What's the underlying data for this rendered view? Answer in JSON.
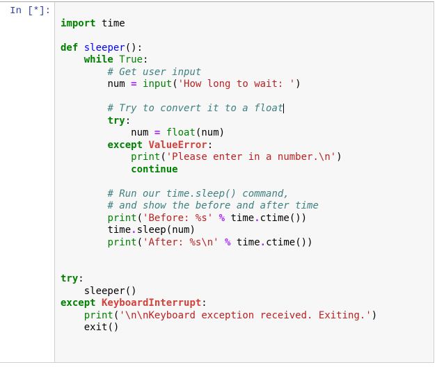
{
  "prompt": {
    "prefix": "In [",
    "indicator": "*",
    "suffix": "]:"
  },
  "code": {
    "l01_kw": "import",
    "l01_nm": " time",
    "l03_kw": "def",
    "l03_fn": " sleeper",
    "l03_pn": "():",
    "l04_sp": "    ",
    "l04_kw": "while",
    "l04_bi": " True",
    "l04_pn": ":",
    "l05_sp": "        ",
    "l05_cm": "# Get user input",
    "l06_sp": "        ",
    "l06_nm1": "num ",
    "l06_op": "=",
    "l06_nm2": " ",
    "l06_bi": "input",
    "l06_pn1": "(",
    "l06_st": "'How long to wait: '",
    "l06_pn2": ")",
    "l08_sp": "        ",
    "l08_cm": "# Try to convert it to a float",
    "l09_sp": "        ",
    "l09_kw": "try",
    "l09_pn": ":",
    "l10_sp": "            ",
    "l10_nm1": "num ",
    "l10_op": "=",
    "l10_nm2": " ",
    "l10_bi": "float",
    "l10_pn1": "(",
    "l10_nm3": "num",
    "l10_pn2": ")",
    "l11_sp": "        ",
    "l11_kw": "except",
    "l11_ex": " ValueError",
    "l11_pn": ":",
    "l12_sp": "            ",
    "l12_bi": "print",
    "l12_pn1": "(",
    "l12_st": "'Please enter in a number.\\n'",
    "l12_pn2": ")",
    "l13_sp": "            ",
    "l13_kw": "continue",
    "l15_sp": "        ",
    "l15_cm": "# Run our time.sleep() command,",
    "l16_sp": "        ",
    "l16_cm": "# and show the before and after time",
    "l17_sp": "        ",
    "l17_bi": "print",
    "l17_pn1": "(",
    "l17_st": "'Before: %s'",
    "l17_nm1": " ",
    "l17_op": "%",
    "l17_nm2": " time",
    "l17_pn2": ".",
    "l17_nm3": "ctime",
    "l17_pn3": "())",
    "l18_sp": "        ",
    "l18_nm1": "time",
    "l18_pn1": ".",
    "l18_nm2": "sleep",
    "l18_pn2": "(",
    "l18_nm3": "num",
    "l18_pn3": ")",
    "l19_sp": "        ",
    "l19_bi": "print",
    "l19_pn1": "(",
    "l19_st": "'After: %s\\n'",
    "l19_nm1": " ",
    "l19_op": "%",
    "l19_nm2": " time",
    "l19_pn2": ".",
    "l19_nm3": "ctime",
    "l19_pn3": "())",
    "l22_kw": "try",
    "l22_pn": ":",
    "l23_sp": "    ",
    "l23_nm": "sleeper",
    "l23_pn": "()",
    "l24_kw": "except",
    "l24_ex": " KeyboardInterrupt",
    "l24_pn": ":",
    "l25_sp": "    ",
    "l25_bi": "print",
    "l25_pn1": "(",
    "l25_st": "'\\n\\nKeyboard exception received. Exiting.'",
    "l25_pn2": ")",
    "l26_sp": "    ",
    "l26_nm": "exit",
    "l26_pn": "()"
  }
}
